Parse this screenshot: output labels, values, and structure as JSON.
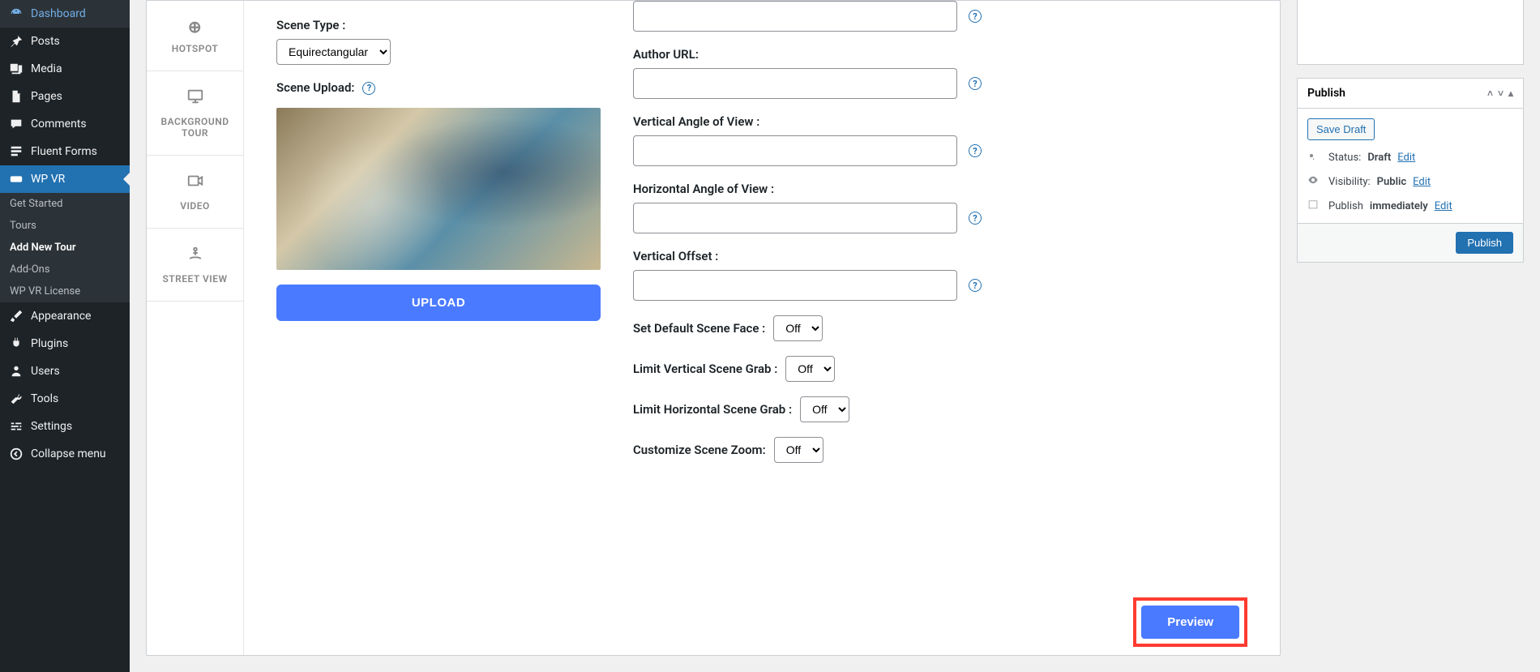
{
  "sidebar": {
    "items": [
      {
        "label": "Dashboard"
      },
      {
        "label": "Posts"
      },
      {
        "label": "Media"
      },
      {
        "label": "Pages"
      },
      {
        "label": "Comments"
      },
      {
        "label": "Fluent Forms"
      },
      {
        "label": "WP VR"
      },
      {
        "label": "Appearance"
      },
      {
        "label": "Plugins"
      },
      {
        "label": "Users"
      },
      {
        "label": "Tools"
      },
      {
        "label": "Settings"
      },
      {
        "label": "Collapse menu"
      }
    ],
    "submenu": [
      {
        "label": "Get Started"
      },
      {
        "label": "Tours"
      },
      {
        "label": "Add New Tour"
      },
      {
        "label": "Add-Ons"
      },
      {
        "label": "WP VR License"
      }
    ]
  },
  "vtabs": {
    "hotspot": "HOTSPOT",
    "background_tour": "BACKGROUND TOUR",
    "video": "VIDEO",
    "street_view": "STREET VIEW"
  },
  "form": {
    "scene_type_label": "Scene Type :",
    "scene_type_value": "Equirectangular",
    "scene_upload_label": "Scene Upload:",
    "upload_btn": "UPLOAD",
    "author_url_label": "Author URL:",
    "vaov_label": "Vertical Angle of View :",
    "haov_label": "Horizontal Angle of View :",
    "voffset_label": "Vertical Offset :",
    "set_default_face_label": "Set Default Scene Face :",
    "limit_vertical_label": "Limit Vertical Scene Grab :",
    "limit_horizontal_label": "Limit Horizontal Scene Grab :",
    "customize_zoom_label": "Customize Scene Zoom:",
    "off_value": "Off",
    "preview_btn": "Preview"
  },
  "publish": {
    "title": "Publish",
    "save_draft": "Save Draft",
    "status_label": "Status:",
    "status_value": "Draft",
    "visibility_label": "Visibility:",
    "visibility_value": "Public",
    "schedule_label": "Publish",
    "schedule_value": "immediately",
    "edit": "Edit",
    "publish_btn": "Publish"
  }
}
